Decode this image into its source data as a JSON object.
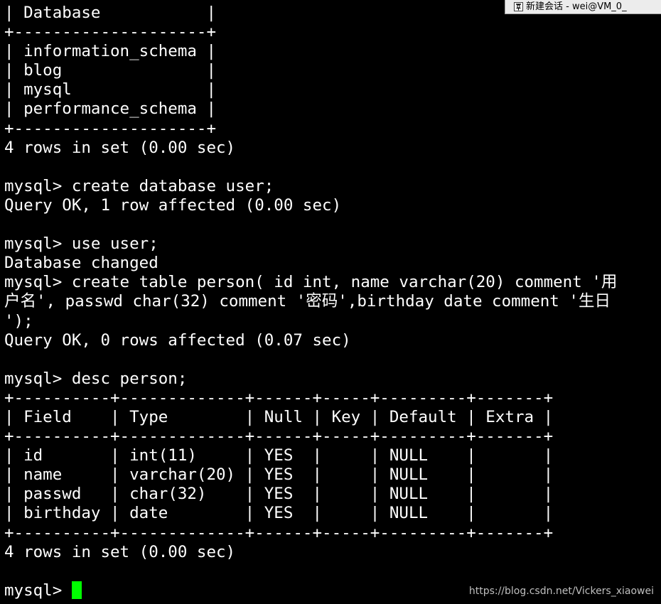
{
  "session_tab": {
    "label": "新建会话 - wei@VM_0_"
  },
  "terminal": {
    "lines": [
      "| Database           |",
      "+--------------------+",
      "| information_schema |",
      "| blog               |",
      "| mysql              |",
      "| performance_schema |",
      "+--------------------+",
      "4 rows in set (0.00 sec)",
      "",
      "mysql> create database user;",
      "Query OK, 1 row affected (0.00 sec)",
      "",
      "mysql> use user;",
      "Database changed",
      "mysql> create table person( id int, name varchar(20) comment '用",
      "户名', passwd char(32) comment '密码',birthday date comment '生日",
      "');",
      "Query OK, 0 rows affected (0.07 sec)",
      "",
      "mysql> desc person;",
      "+----------+-------------+------+-----+---------+-------+",
      "| Field    | Type        | Null | Key | Default | Extra |",
      "+----------+-------------+------+-----+---------+-------+",
      "| id       | int(11)     | YES  |     | NULL    |       |",
      "| name     | varchar(20) | YES  |     | NULL    |       |",
      "| passwd   | char(32)    | YES  |     | NULL    |       |",
      "| birthday | date        | YES  |     | NULL    |       |",
      "+----------+-------------+------+-----+---------+-------+",
      "4 rows in set (0.00 sec)",
      ""
    ],
    "prompt": "mysql> ",
    "cursor_color": "#00ff00",
    "background": "#000000",
    "foreground": "#ffffff"
  },
  "watermark": {
    "text": "https://blog.csdn.net/Vickers_xiaowei"
  },
  "icons": {
    "pin": "pin-icon"
  }
}
